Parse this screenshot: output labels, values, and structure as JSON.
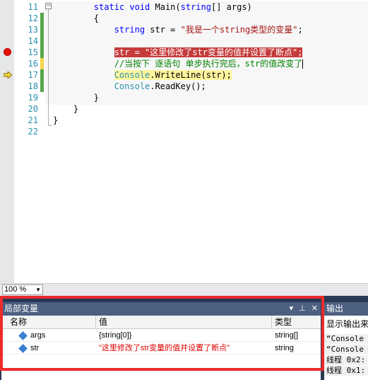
{
  "editor": {
    "lines": [
      {
        "num": "11",
        "code": "        static void Main(string[] args)"
      },
      {
        "num": "12",
        "code": "        {"
      },
      {
        "num": "13",
        "code": "            string str = \"我是一个string类型的变量\";"
      },
      {
        "num": "14",
        "code": ""
      },
      {
        "num": "15",
        "code": "            str = \"这里修改了str变量的值并设置了断点\";"
      },
      {
        "num": "16",
        "code": "            //当按下 逐语句 单步执行完后，str的值改变了"
      },
      {
        "num": "17",
        "code": "            Console.WriteLine(str);"
      },
      {
        "num": "18",
        "code": "            Console.ReadKey();"
      },
      {
        "num": "19",
        "code": "        }"
      },
      {
        "num": "20",
        "code": "    }"
      },
      {
        "num": "21",
        "code": "}"
      },
      {
        "num": "22",
        "code": ""
      }
    ]
  },
  "zoom": {
    "value": "100 %"
  },
  "locals": {
    "title": "局部变量",
    "columns": {
      "name": "名称",
      "value": "值",
      "type": "类型"
    },
    "rows": [
      {
        "name": "args",
        "value": "{string[0]}",
        "type": "string[]"
      },
      {
        "name": "str",
        "value": "\"这里修改了str变量的值并设置了断点\"",
        "type": "string"
      }
    ]
  },
  "output": {
    "title": "输出",
    "source_label": "显示输出来",
    "lines": [
      "“Console",
      "“Console",
      "线程 0x2:",
      "线程 0x1:"
    ]
  },
  "colors": {
    "breakpoint": "#e51400",
    "annotation_frame": "#ee2b2b",
    "panel_title": "#4d6082"
  }
}
